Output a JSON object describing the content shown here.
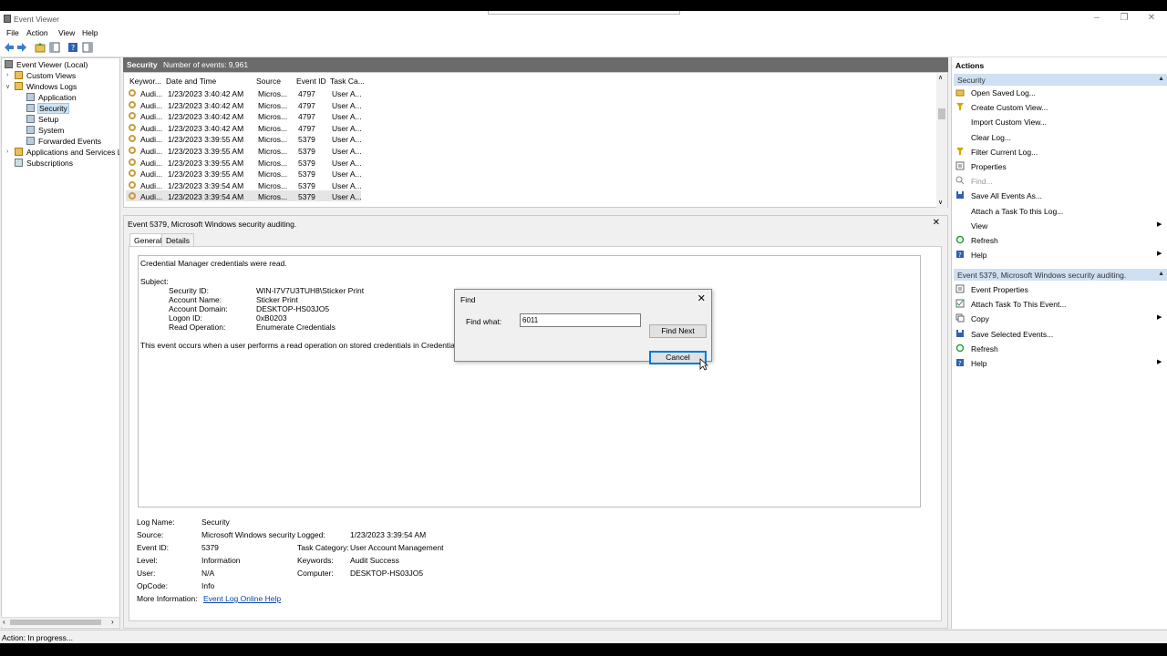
{
  "window": {
    "title": "Event Viewer"
  },
  "menu": [
    "File",
    "Action",
    "View",
    "Help"
  ],
  "tree": {
    "root": "Event Viewer (Local)",
    "custom_views": "Custom Views",
    "windows_logs": "Windows Logs",
    "logs": [
      "Application",
      "Security",
      "Setup",
      "System",
      "Forwarded Events"
    ],
    "apps_services": "Applications and Services Lo",
    "subscriptions": "Subscriptions"
  },
  "log_header": {
    "name": "Security",
    "count": "Number of events: 9,961"
  },
  "columns": [
    "Keywor...",
    "Date and Time",
    "Source",
    "Event ID",
    "Task Ca..."
  ],
  "events": [
    [
      "Audi...",
      "1/23/2023 3:40:42 AM",
      "Micros...",
      "4797",
      "User A..."
    ],
    [
      "Audi...",
      "1/23/2023 3:40:42 AM",
      "Micros...",
      "4797",
      "User A..."
    ],
    [
      "Audi...",
      "1/23/2023 3:40:42 AM",
      "Micros...",
      "4797",
      "User A..."
    ],
    [
      "Audi...",
      "1/23/2023 3:40:42 AM",
      "Micros...",
      "4797",
      "User A..."
    ],
    [
      "Audi...",
      "1/23/2023 3:39:55 AM",
      "Micros...",
      "5379",
      "User A..."
    ],
    [
      "Audi...",
      "1/23/2023 3:39:55 AM",
      "Micros...",
      "5379",
      "User A..."
    ],
    [
      "Audi...",
      "1/23/2023 3:39:55 AM",
      "Micros...",
      "5379",
      "User A..."
    ],
    [
      "Audi...",
      "1/23/2023 3:39:55 AM",
      "Micros...",
      "5379",
      "User A..."
    ],
    [
      "Audi...",
      "1/23/2023 3:39:54 AM",
      "Micros...",
      "5379",
      "User A..."
    ],
    [
      "Audi...",
      "1/23/2023 3:39:54 AM",
      "Micros...",
      "5379",
      "User A..."
    ]
  ],
  "selected_event_index": 9,
  "details": {
    "header": "Event 5379, Microsoft Windows security auditing.",
    "tabs": [
      "General",
      "Details"
    ],
    "message": "Credential Manager credentials were read.",
    "subject_label": "Subject:",
    "subject": [
      [
        "Security ID:",
        "WIN-I7V7U3TUH8\\Sticker Print"
      ],
      [
        "Account Name:",
        "Sticker Print"
      ],
      [
        "Account Domain:",
        "DESKTOP-HS03JO5"
      ],
      [
        "Logon ID:",
        "0xB0203"
      ],
      [
        "Read Operation:",
        "Enumerate Credentials"
      ]
    ],
    "note": "This event occurs when a user performs a read operation on stored credentials in Credential Manag",
    "props": {
      "log_name_label": "Log Name:",
      "log_name": "Security",
      "source_label": "Source:",
      "source": "Microsoft Windows security",
      "logged_label": "Logged:",
      "logged": "1/23/2023 3:39:54 AM",
      "event_id_label": "Event ID:",
      "event_id": "5379",
      "task_label": "Task Category:",
      "task": "User Account Management",
      "level_label": "Level:",
      "level": "Information",
      "keywords_label": "Keywords:",
      "keywords": "Audit Success",
      "user_label": "User:",
      "user": "N/A",
      "computer_label": "Computer:",
      "computer": "DESKTOP-HS03JO5",
      "opcode_label": "OpCode:",
      "opcode": "Info",
      "more_label": "More Information:",
      "more_link": "Event Log Online Help"
    }
  },
  "actions": {
    "title": "Actions",
    "section1": "Security",
    "items1": [
      {
        "label": "Open Saved Log...",
        "icon": "folder-open-icon"
      },
      {
        "label": "Create Custom View...",
        "icon": "filter-icon"
      },
      {
        "label": "Import Custom View...",
        "icon": ""
      },
      {
        "label": "Clear Log...",
        "icon": ""
      },
      {
        "label": "Filter Current Log...",
        "icon": "filter-icon"
      },
      {
        "label": "Properties",
        "icon": "properties-icon"
      },
      {
        "label": "Find...",
        "icon": "find-icon"
      },
      {
        "label": "Save All Events As...",
        "icon": "save-icon"
      },
      {
        "label": "Attach a Task To this Log...",
        "icon": ""
      },
      {
        "label": "View",
        "icon": ""
      },
      {
        "label": "Refresh",
        "icon": "refresh-icon"
      },
      {
        "label": "Help",
        "icon": "help-icon"
      }
    ],
    "section2": "Event 5379, Microsoft Windows security auditing.",
    "items2": [
      {
        "label": "Event Properties",
        "icon": "properties-icon"
      },
      {
        "label": "Attach Task To This Event...",
        "icon": "task-icon"
      },
      {
        "label": "Copy",
        "icon": "copy-icon"
      },
      {
        "label": "Save Selected Events...",
        "icon": "save-icon"
      },
      {
        "label": "Refresh",
        "icon": "refresh-icon"
      },
      {
        "label": "Help",
        "icon": "help-icon"
      }
    ]
  },
  "status": "Action:  In progress...",
  "find_dialog": {
    "title": "Find",
    "label": "Find what:",
    "value": "6011",
    "find_next": "Find Next",
    "cancel": "Cancel"
  },
  "colors": {
    "header_bg": "#6b6b6b",
    "action_section_bg": "#cfe0f3",
    "selection": "#cce4f7"
  }
}
